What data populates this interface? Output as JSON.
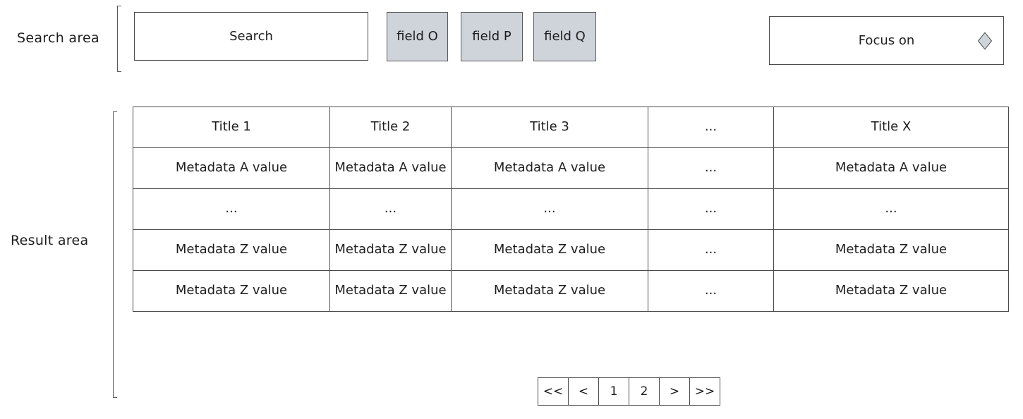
{
  "search_area": {
    "label": "Search area",
    "search_button": "Search",
    "fields": [
      "field O",
      "field P",
      "field Q"
    ],
    "focus_select": {
      "value": "Focus on",
      "icon": "diamond-icon"
    }
  },
  "result_area": {
    "label": "Result area",
    "columns": [
      "Title 1",
      "Title 2",
      "Title 3",
      "...",
      "Title X"
    ],
    "rows": [
      [
        "Metadata A value",
        "Metadata A value",
        "Metadata A value",
        "...",
        "Metadata A value"
      ],
      [
        "...",
        "...",
        "...",
        "...",
        "..."
      ],
      [
        "Metadata Z value",
        "Metadata Z value",
        "Metadata Z value",
        "...",
        "Metadata Z value"
      ],
      [
        "Metadata Z value",
        "Metadata Z value",
        "Metadata Z value",
        "...",
        "Metadata Z value"
      ]
    ]
  },
  "pagination": {
    "first": "<<",
    "prev": "<",
    "pages": [
      "1",
      "2"
    ],
    "next": ">",
    "last": ">>"
  },
  "colors": {
    "field_fill": "#ced4da",
    "stroke": "#4a4a4a",
    "text": "#1e1e1e"
  }
}
